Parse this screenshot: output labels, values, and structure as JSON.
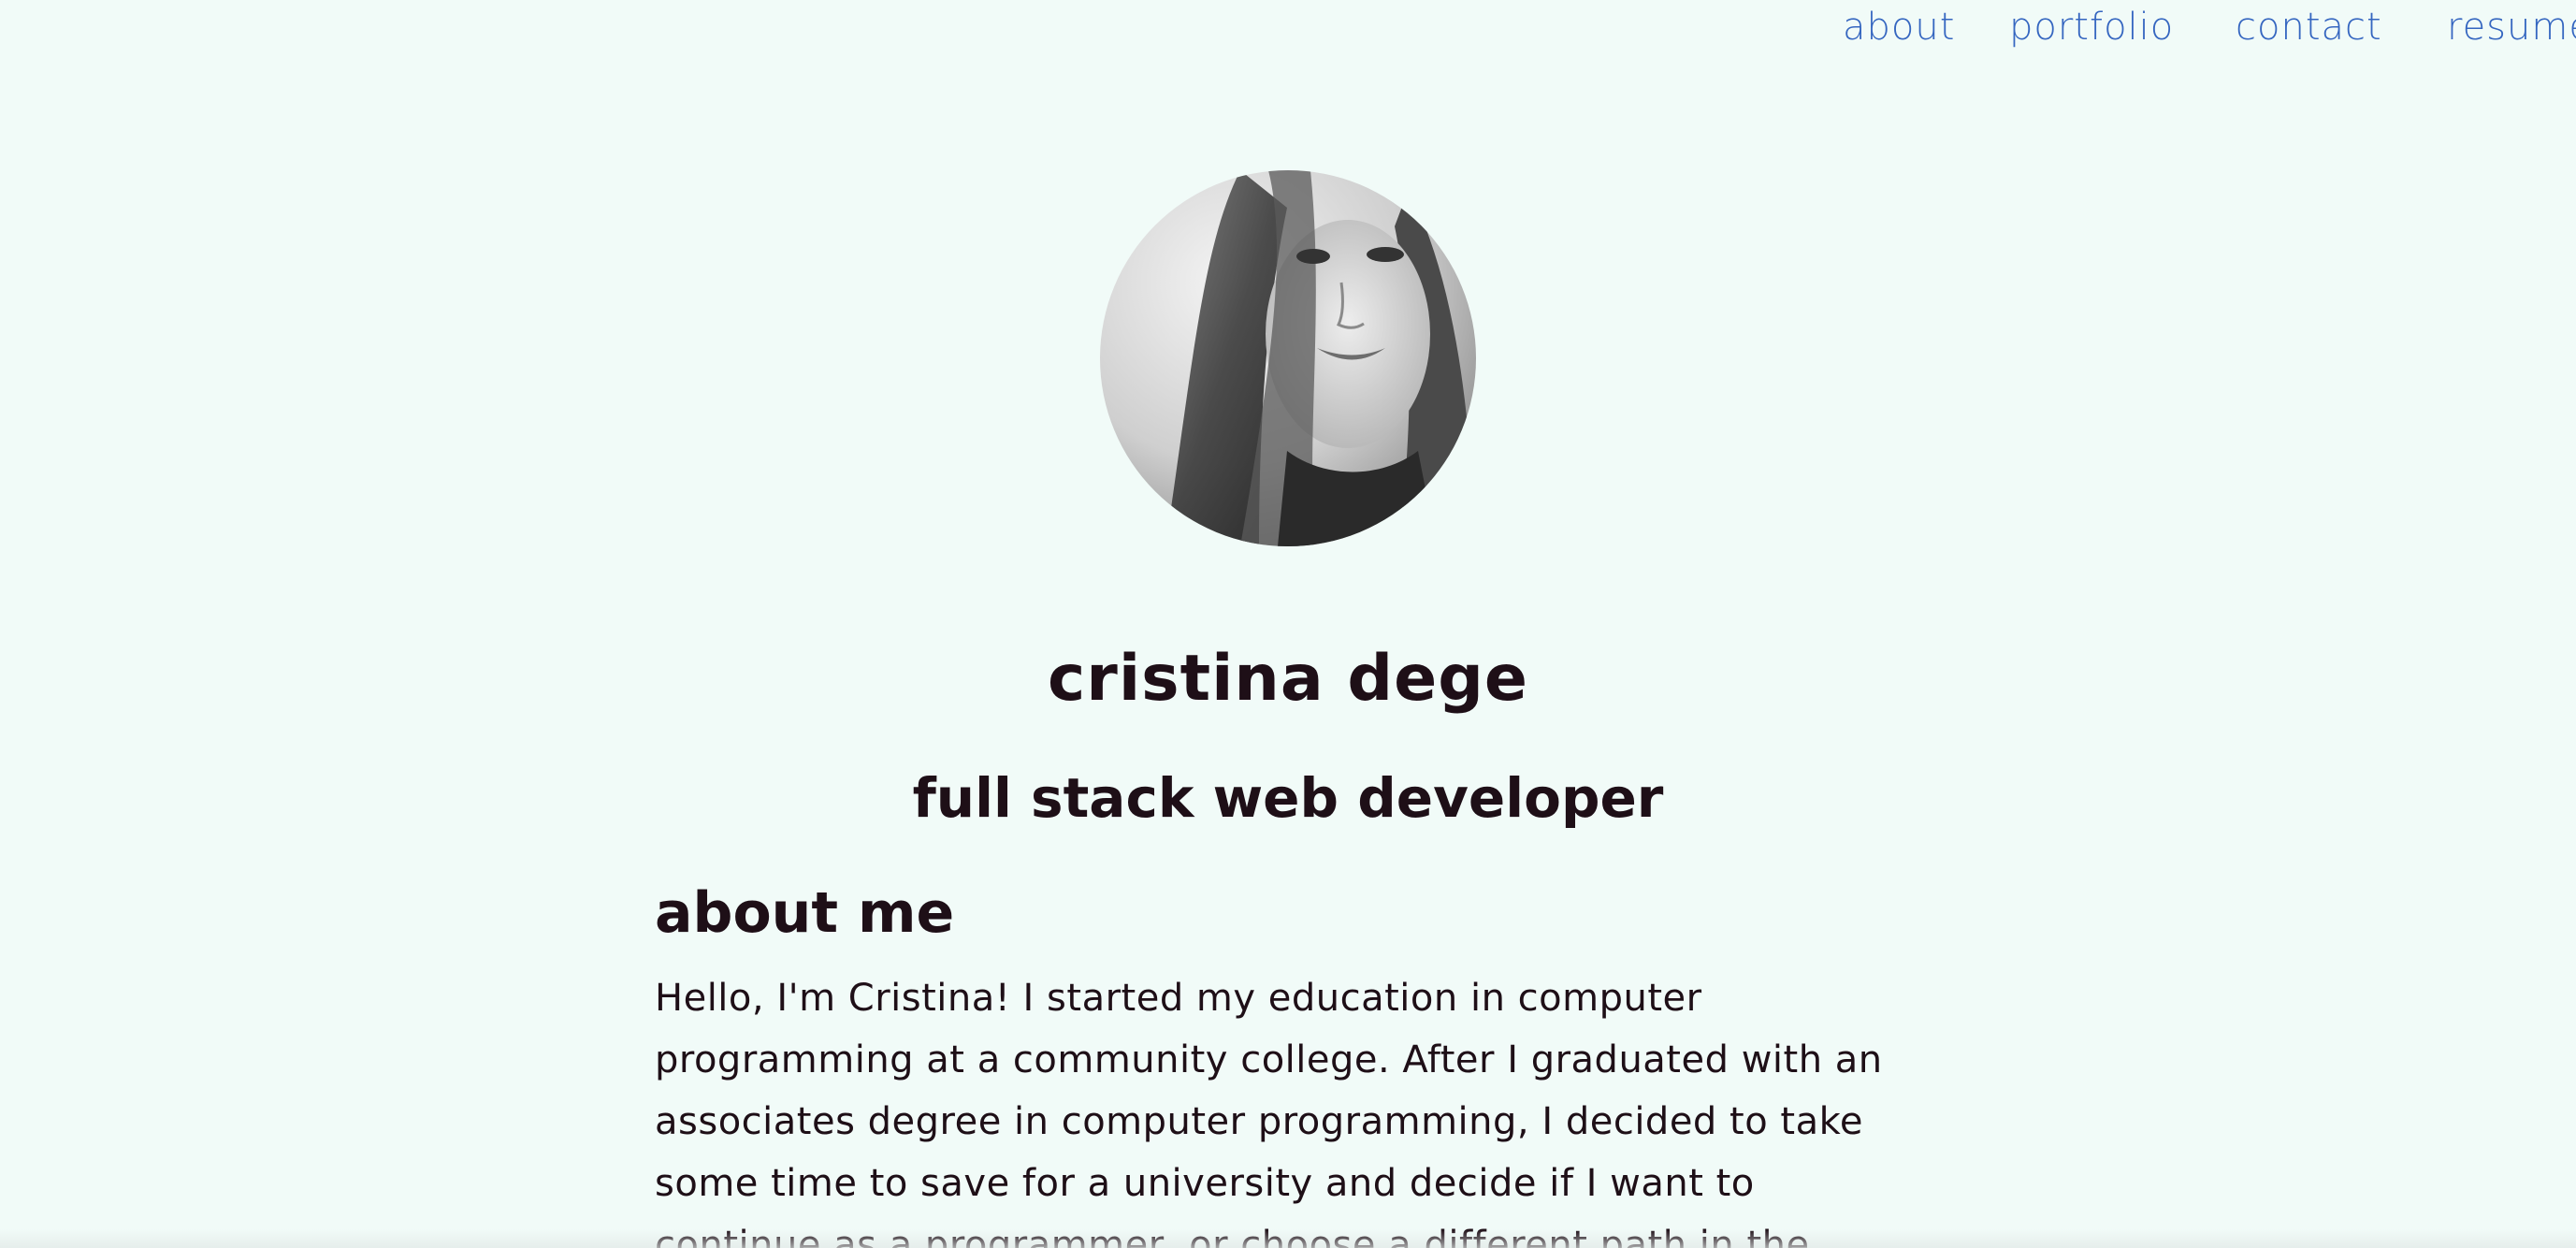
{
  "nav": {
    "items": [
      {
        "label": "about"
      },
      {
        "label": "portfolio"
      },
      {
        "label": "contact"
      },
      {
        "label": "resume"
      }
    ]
  },
  "profile": {
    "name": "cristina dege",
    "title": "full stack web developer"
  },
  "about": {
    "heading": "about me",
    "text": "Hello, I'm Cristina! I started my education in computer programming at a community college. After I graduated with an associates degree in computer programming, I decided to take some time to save for a university and decide if I want to continue as a programmer, or choose a different path in the"
  },
  "colors": {
    "background": "#f1fbf8",
    "nav_link": "#3566c0",
    "text": "#1e0f17"
  }
}
